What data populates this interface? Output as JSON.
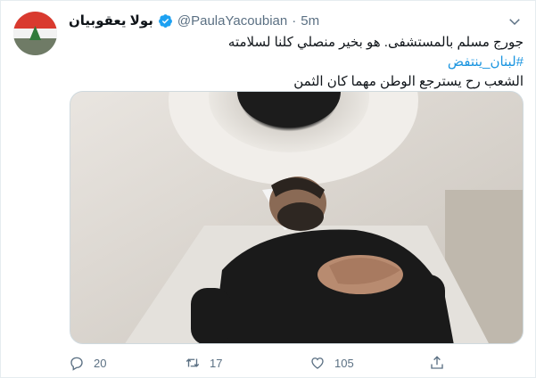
{
  "tweet": {
    "display_name": "بولا يعقوبيان",
    "handle": "@PaulaYacoubian",
    "separator": "·",
    "time": "5m",
    "text_line1": "جورج مسلم بالمستشفى. هو بخير منصلي كلنا لسلامته",
    "hashtag": "#لبنان_ينتفض",
    "text_line3": "الشعب رح يسترجع الوطن مهما كان الثمن",
    "image_description": "",
    "stats": {
      "replies": "20",
      "retweets": "17",
      "likes": "105"
    }
  },
  "icons": {
    "verified": "verified-badge-icon",
    "caret": "chevron-down-icon",
    "reply": "reply-icon",
    "retweet": "retweet-icon",
    "like": "heart-icon",
    "share": "share-icon"
  },
  "colors": {
    "accent": "#1da1f2",
    "hashtag": "#1b95e0",
    "muted": "#5b7083",
    "text": "#0f1419"
  }
}
